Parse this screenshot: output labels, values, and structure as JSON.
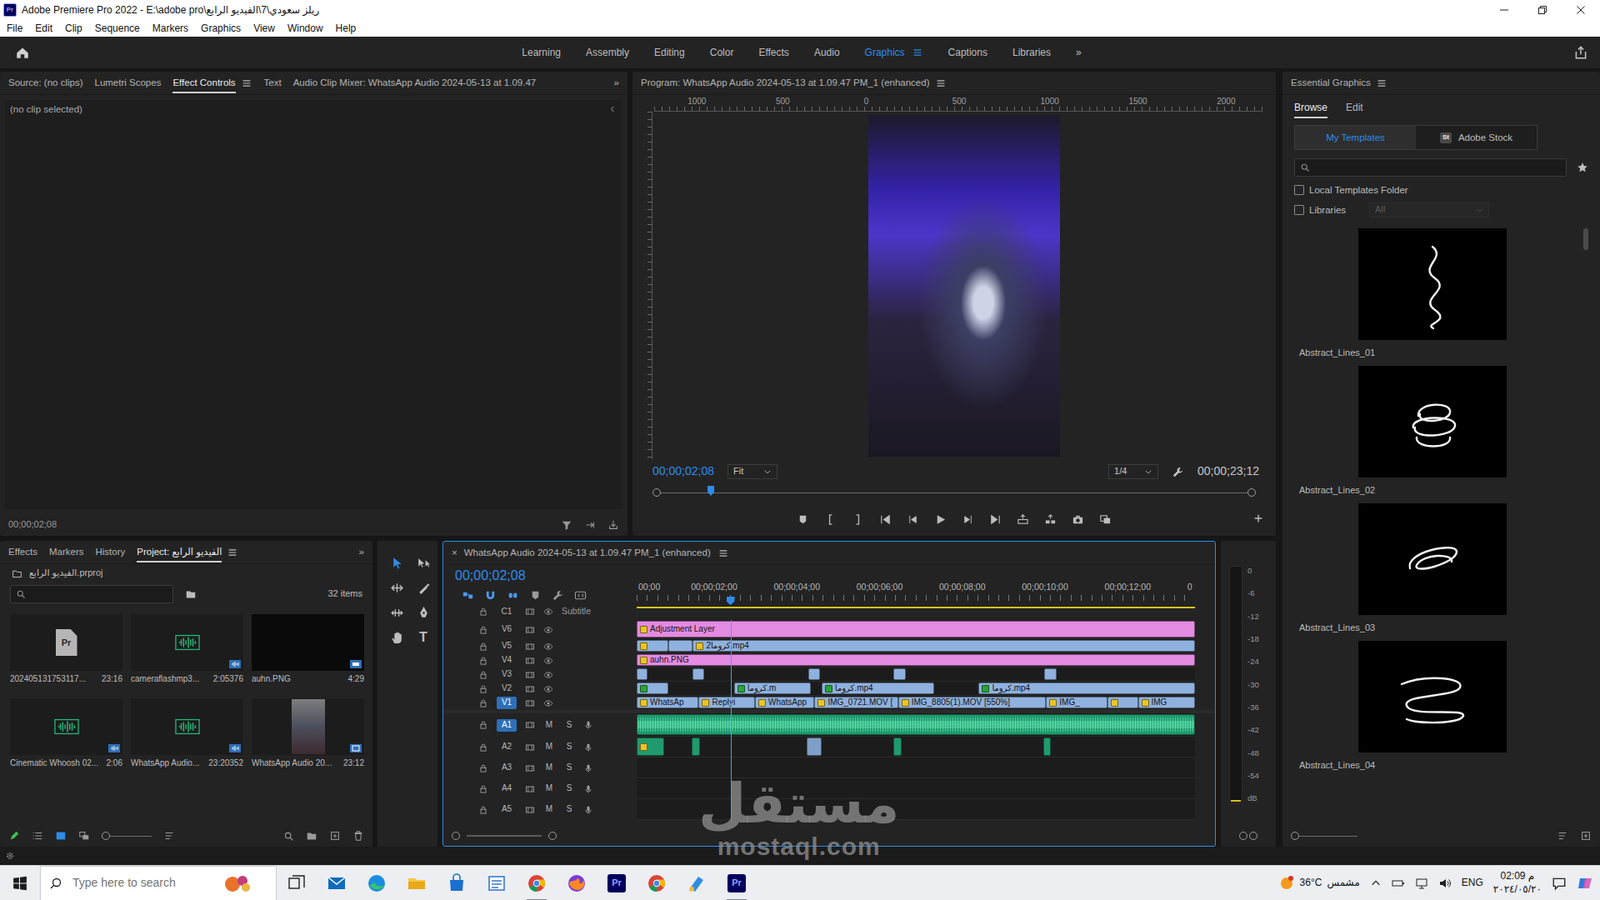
{
  "window": {
    "icon_text": "Pr",
    "title": "Adobe Premiere Pro 2022 - E:\\adobe pro\\ريلز سعودي\\7\\الفيديو الرابع"
  },
  "menu": [
    "File",
    "Edit",
    "Clip",
    "Sequence",
    "Markers",
    "Graphics",
    "View",
    "Window",
    "Help"
  ],
  "workspaces": {
    "items": [
      {
        "label": "Learning",
        "selected": false
      },
      {
        "label": "Assembly",
        "selected": false
      },
      {
        "label": "Editing",
        "selected": false
      },
      {
        "label": "Color",
        "selected": false
      },
      {
        "label": "Effects",
        "selected": false
      },
      {
        "label": "Audio",
        "selected": false
      },
      {
        "label": "Graphics",
        "selected": true
      },
      {
        "label": "Captions",
        "selected": false
      },
      {
        "label": "Libraries",
        "selected": false
      }
    ],
    "overflow": "»"
  },
  "source_panel": {
    "tabs": [
      {
        "label": "Source: (no clips)",
        "selected": false
      },
      {
        "label": "Lumetri Scopes",
        "selected": false
      },
      {
        "label": "Effect Controls",
        "selected": true
      },
      {
        "label": "Text",
        "selected": false
      },
      {
        "label": "Audio Clip Mixer: WhatsApp Audio 2024-05-13 at 1.09.47",
        "selected": false
      }
    ],
    "overflow": "»",
    "message": "(no clip selected)",
    "timecode": "00;00;02;08"
  },
  "program": {
    "title": "Program: WhatsApp Audio 2024-05-13 at 1.09.47 PM_1 (enhanced)",
    "ruler": [
      "1000",
      "500",
      "0",
      "500",
      "1000",
      "1500",
      "2000"
    ],
    "timecode": "00;00;02;08",
    "zoom": "Fit",
    "resolution": "1/4",
    "duration": "00;00;23;12",
    "playhead": {
      "level": 0.09
    }
  },
  "essential_graphics": {
    "title": "Essential Graphics",
    "tabs": [
      {
        "label": "Browse",
        "selected": true
      },
      {
        "label": "Edit",
        "selected": false
      }
    ],
    "sources": [
      {
        "label": "My Templates",
        "selected": true
      },
      {
        "label": "Adobe Stock",
        "selected": false,
        "icon_text": "St"
      }
    ],
    "options": [
      {
        "label": "Local Templates Folder",
        "checked": false
      },
      {
        "label": "Libraries",
        "checked": false
      }
    ],
    "library_select": {
      "value": "All",
      "disabled": true
    },
    "templates": [
      {
        "label": "Abstract_Lines_01"
      },
      {
        "label": "Abstract_Lines_02"
      },
      {
        "label": "Abstract_Lines_03"
      },
      {
        "label": "Abstract_Lines_04"
      }
    ]
  },
  "project": {
    "tabs": [
      {
        "label": "Effects",
        "selected": false
      },
      {
        "label": "Markers",
        "selected": false
      },
      {
        "label": "History",
        "selected": false
      },
      {
        "label": "Project: الفيديو الرابع",
        "selected": true
      }
    ],
    "overflow": "»",
    "file": "الفيديو الرابع.prproj",
    "count": "32 items",
    "items": [
      {
        "name": "202405131753117...",
        "duration": "23:16",
        "kind": "project",
        "icon_text": "Pr"
      },
      {
        "name": "cameraflashmp3...",
        "duration": "2:05376",
        "kind": "audio"
      },
      {
        "name": "auhn.PNG",
        "duration": "4:29",
        "kind": "image"
      },
      {
        "name": "Cinematic Whoosh 02...",
        "duration": "2:06",
        "kind": "audio"
      },
      {
        "name": "WhatsApp Audio...",
        "duration": "23:20352",
        "kind": "audio"
      },
      {
        "name": "WhatsApp Audio 20...",
        "duration": "23:12",
        "kind": "video"
      }
    ]
  },
  "tools": [
    {
      "kind": "selection",
      "selected": true
    },
    {
      "kind": "track-select",
      "selected": false
    },
    {
      "kind": "ripple",
      "selected": false
    },
    {
      "kind": "razor",
      "selected": false
    },
    {
      "kind": "slip",
      "selected": false
    },
    {
      "kind": "pen",
      "selected": false
    },
    {
      "kind": "hand",
      "selected": false
    },
    {
      "kind": "type",
      "label": "T",
      "selected": false
    }
  ],
  "timeline": {
    "close": "×",
    "title": "WhatsApp Audio 2024-05-13 at 1.09.47 PM_1 (enhanced)",
    "timecode": "00;00;02;08",
    "visible_seconds": 13.5,
    "playhead": {
      "level": 0.168
    },
    "toolbar": [
      {
        "kind": "nest",
        "on": true
      },
      {
        "kind": "snap",
        "on": true
      },
      {
        "kind": "linked",
        "on": true
      },
      {
        "kind": "marker",
        "on": false
      },
      {
        "kind": "settings",
        "on": false
      },
      {
        "kind": "captions",
        "on": false
      }
    ],
    "ruler": [
      "00;00",
      "00;00;02;00",
      "00;00;04;00",
      "00;00;06;00",
      "00;00;08;00",
      "00;00;10;00",
      "00;00;12;00",
      "0"
    ],
    "caption_track": {
      "name": "C1",
      "label": "Subtitle"
    },
    "video_tracks": [
      {
        "name": "V6",
        "targeted": false,
        "clips": [
          {
            "label": "Adjustment Layer",
            "start": 0,
            "end": 13.5,
            "color": "#e48be2",
            "kind": "effect"
          }
        ]
      },
      {
        "name": "V5",
        "targeted": false,
        "clips": [
          {
            "start": 0,
            "end": 0.77,
            "color": "#8fb1de",
            "kind": "effect"
          },
          {
            "start": 0.77,
            "end": 1.36,
            "color": "#8fb1de",
            "kind": "plain"
          },
          {
            "label": "كروما2.mp4",
            "start": 1.36,
            "end": 13.5,
            "color": "#8fb1de",
            "kind": "effect"
          }
        ]
      },
      {
        "name": "V4",
        "targeted": false,
        "clips": [
          {
            "label": "auhn.PNG",
            "start": 0,
            "end": 13.5,
            "color": "#e48be2",
            "kind": "effect"
          }
        ]
      },
      {
        "name": "V3",
        "targeted": false,
        "clips": [
          {
            "start": 0,
            "end": 0.27,
            "color": "#8fb1de",
            "kind": "plain"
          },
          {
            "start": 1.36,
            "end": 1.63,
            "color": "#8fb1de",
            "kind": "plain"
          },
          {
            "start": 4.15,
            "end": 4.44,
            "color": "#8fb1de",
            "kind": "plain"
          },
          {
            "start": 6.2,
            "end": 6.5,
            "color": "#8fb1de",
            "kind": "plain"
          },
          {
            "start": 9.85,
            "end": 10.15,
            "color": "#8fb1de",
            "kind": "plain"
          }
        ]
      },
      {
        "name": "V2",
        "targeted": false,
        "clips": [
          {
            "start": 0,
            "end": 0.77,
            "color": "#8fb1de",
            "kind": "keyed"
          },
          {
            "label": "كروما.m",
            "start": 2.35,
            "end": 4.22,
            "color": "#8fb1de",
            "kind": "keyed"
          },
          {
            "label": "كروما.mp4",
            "start": 4.47,
            "end": 7.19,
            "color": "#8fb1de",
            "kind": "keyed"
          },
          {
            "label": "كروما.mp4",
            "start": 8.27,
            "end": 13.5,
            "color": "#8fb1de",
            "kind": "keyed"
          }
        ]
      },
      {
        "name": "V1",
        "targeted": true,
        "clips": [
          {
            "label": "WhatsAp",
            "start": 0,
            "end": 1.5,
            "color": "#8fb1de",
            "kind": "effect"
          },
          {
            "label": "Replyi",
            "start": 1.5,
            "end": 2.86,
            "color": "#8fb1de",
            "kind": "effect"
          },
          {
            "label": "WhatsApp",
            "start": 2.86,
            "end": 4.3,
            "color": "#8fb1de",
            "kind": "effect"
          },
          {
            "label": "IMG_0721.MOV [",
            "start": 4.3,
            "end": 6.32,
            "color": "#8fb1de",
            "kind": "effect"
          },
          {
            "label": "IMG_8805(1).MOV [550%]",
            "start": 6.32,
            "end": 9.9,
            "color": "#8fb1de",
            "kind": "effect"
          },
          {
            "label": "IMG_",
            "start": 9.9,
            "end": 11.38,
            "color": "#8fb1de",
            "kind": "effect"
          },
          {
            "start": 11.38,
            "end": 12.12,
            "color": "#8fb1de",
            "kind": "effect"
          },
          {
            "label": "IMG",
            "start": 12.12,
            "end": 13.5,
            "color": "#8fb1de",
            "kind": "effect"
          }
        ]
      }
    ],
    "audio_tracks": [
      {
        "name": "A1",
        "targeted": true,
        "mute": "M",
        "solo": "S",
        "clips": [
          {
            "start": 0,
            "end": 13.5,
            "color": "#1f9a6c",
            "kind": "wave"
          }
        ]
      },
      {
        "name": "A2",
        "targeted": false,
        "mute": "M",
        "solo": "S",
        "clips": [
          {
            "start": 0,
            "end": 0.67,
            "color": "#1f9a6c",
            "kind": "effect"
          },
          {
            "start": 1.33,
            "end": 1.53,
            "color": "#1f9a6c",
            "kind": "plain"
          },
          {
            "start": 4.12,
            "end": 4.47,
            "color": "#7f9fc8",
            "kind": "plain"
          },
          {
            "start": 6.2,
            "end": 6.4,
            "color": "#1f9a6c",
            "kind": "plain"
          },
          {
            "start": 9.83,
            "end": 10.02,
            "color": "#1f9a6c",
            "kind": "plain"
          }
        ]
      },
      {
        "name": "A3",
        "targeted": false,
        "mute": "M",
        "solo": "S",
        "clips": []
      },
      {
        "name": "A4",
        "targeted": false,
        "mute": "M",
        "solo": "S",
        "clips": []
      },
      {
        "name": "A5",
        "targeted": false,
        "mute": "M",
        "solo": "S",
        "clips": []
      }
    ]
  },
  "meter": {
    "scale": [
      "0",
      "-6",
      "-12",
      "-18",
      "-24",
      "-30",
      "-36",
      "-42",
      "-48",
      "-54",
      "dB"
    ]
  },
  "taskbar": {
    "search_placeholder": "Type here to search",
    "apps": [
      {
        "kind": "task-view",
        "running": false
      },
      {
        "kind": "mail",
        "running": false
      },
      {
        "kind": "edge",
        "running": false
      },
      {
        "kind": "explorer",
        "running": false
      },
      {
        "kind": "store",
        "running": false
      },
      {
        "kind": "notepad",
        "running": false
      },
      {
        "kind": "chrome",
        "running": true
      },
      {
        "kind": "firefox",
        "running": false
      },
      {
        "kind": "premiere",
        "label": "Pr",
        "running": false
      },
      {
        "kind": "chrome",
        "running": false
      },
      {
        "kind": "paint",
        "running": false
      },
      {
        "kind": "premiere",
        "label": "Pr",
        "running": true
      }
    ],
    "weather": {
      "temp": "36°C",
      "condition": "مشمس"
    },
    "language": "ENG",
    "time": "02:09 م",
    "date": "٢٠٢٤/٠٥/٢٠"
  },
  "watermark": {
    "brand": "مستقل",
    "site": "mostaql.com"
  }
}
